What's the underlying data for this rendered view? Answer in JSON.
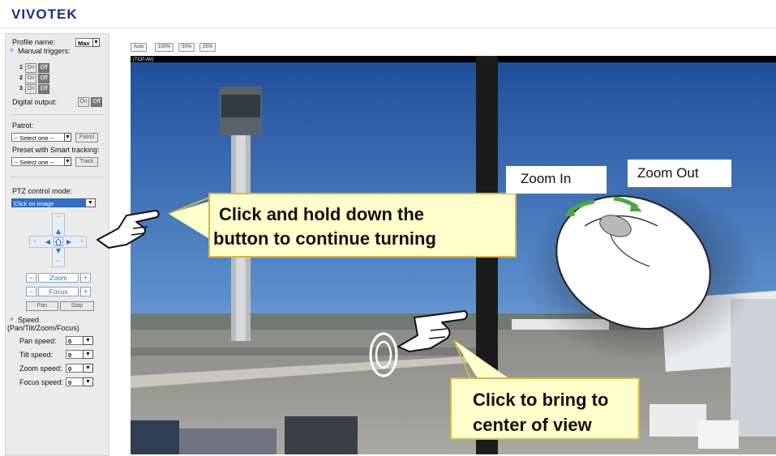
{
  "brand": {
    "logo": "VIVOTEK"
  },
  "view_sizes": [
    "Auto",
    "100%",
    "50%",
    "25%"
  ],
  "stream_label": "(TCP-AV)",
  "panel": {
    "profile_label": "Profile name:",
    "profile_value": "Max",
    "manual_triggers_label": "Manual triggers:",
    "triggers": [
      {
        "num": "1",
        "on": "On",
        "off": "Off"
      },
      {
        "num": "2",
        "on": "On",
        "off": "Off"
      },
      {
        "num": "3",
        "on": "On",
        "off": "Off"
      }
    ],
    "digital_output_label": "Digital output:",
    "digital_on": "On",
    "digital_off": "Off",
    "patrol_label": "Patrol:",
    "patrol_select": "-- Select one --",
    "patrol_button": "Patrol",
    "preset_label": "Preset with Smart tracking:",
    "preset_select": "-- Select one --",
    "track_button": "Track",
    "ptz_mode_label": "PTZ control mode:",
    "ptz_mode_value": "Click on image",
    "zoom_minus": "−",
    "zoom_label": "Zoom",
    "zoom_plus": "+",
    "focus_minus": "−",
    "focus_label": "Focus",
    "focus_plus": "+",
    "pan_button": "Pan",
    "stop_button": "Stop",
    "speed_title": "Speed",
    "speed_subtitle": "(Pan/Tilt/Zoom/Focus)",
    "speeds": [
      {
        "label": "Pan speed:",
        "value": "0"
      },
      {
        "label": "Tilt speed:",
        "value": "0"
      },
      {
        "label": "Zoom speed:",
        "value": "0"
      },
      {
        "label": "Focus speed:",
        "value": "0"
      }
    ]
  },
  "callouts": {
    "hold_line1": "Click and hold down the",
    "hold_line2": "button to continue turning",
    "center_line1": "Click to bring to",
    "center_line2": "center of view",
    "zoom_in": "Zoom In",
    "zoom_out": "Zoom Out"
  },
  "colors": {
    "brand": "#1a2f8a",
    "callout_bg": "#ffffcc",
    "callout_border": "#d9b64a",
    "ptz_select": "#3370c5"
  }
}
